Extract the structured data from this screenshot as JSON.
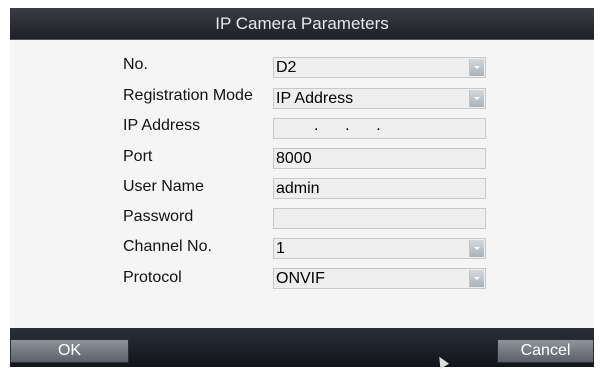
{
  "dialog": {
    "title": "IP Camera Parameters"
  },
  "form": {
    "no": {
      "label": "No.",
      "value": "D2"
    },
    "registration_mode": {
      "label": "Registration Mode",
      "value": "IP Address"
    },
    "ip_address": {
      "label": "IP Address",
      "value": ".      .      ."
    },
    "port": {
      "label": "Port",
      "value": "8000"
    },
    "user_name": {
      "label": "User Name",
      "value": "admin"
    },
    "password": {
      "label": "Password",
      "value": ""
    },
    "channel_no": {
      "label": "Channel No.",
      "value": "1"
    },
    "protocol": {
      "label": "Protocol",
      "value": "ONVIF"
    }
  },
  "buttons": {
    "ok": "OK",
    "cancel": "Cancel"
  },
  "icons": {
    "dropdown": "chevron-down-icon",
    "cursor": "mouse-cursor-icon"
  }
}
